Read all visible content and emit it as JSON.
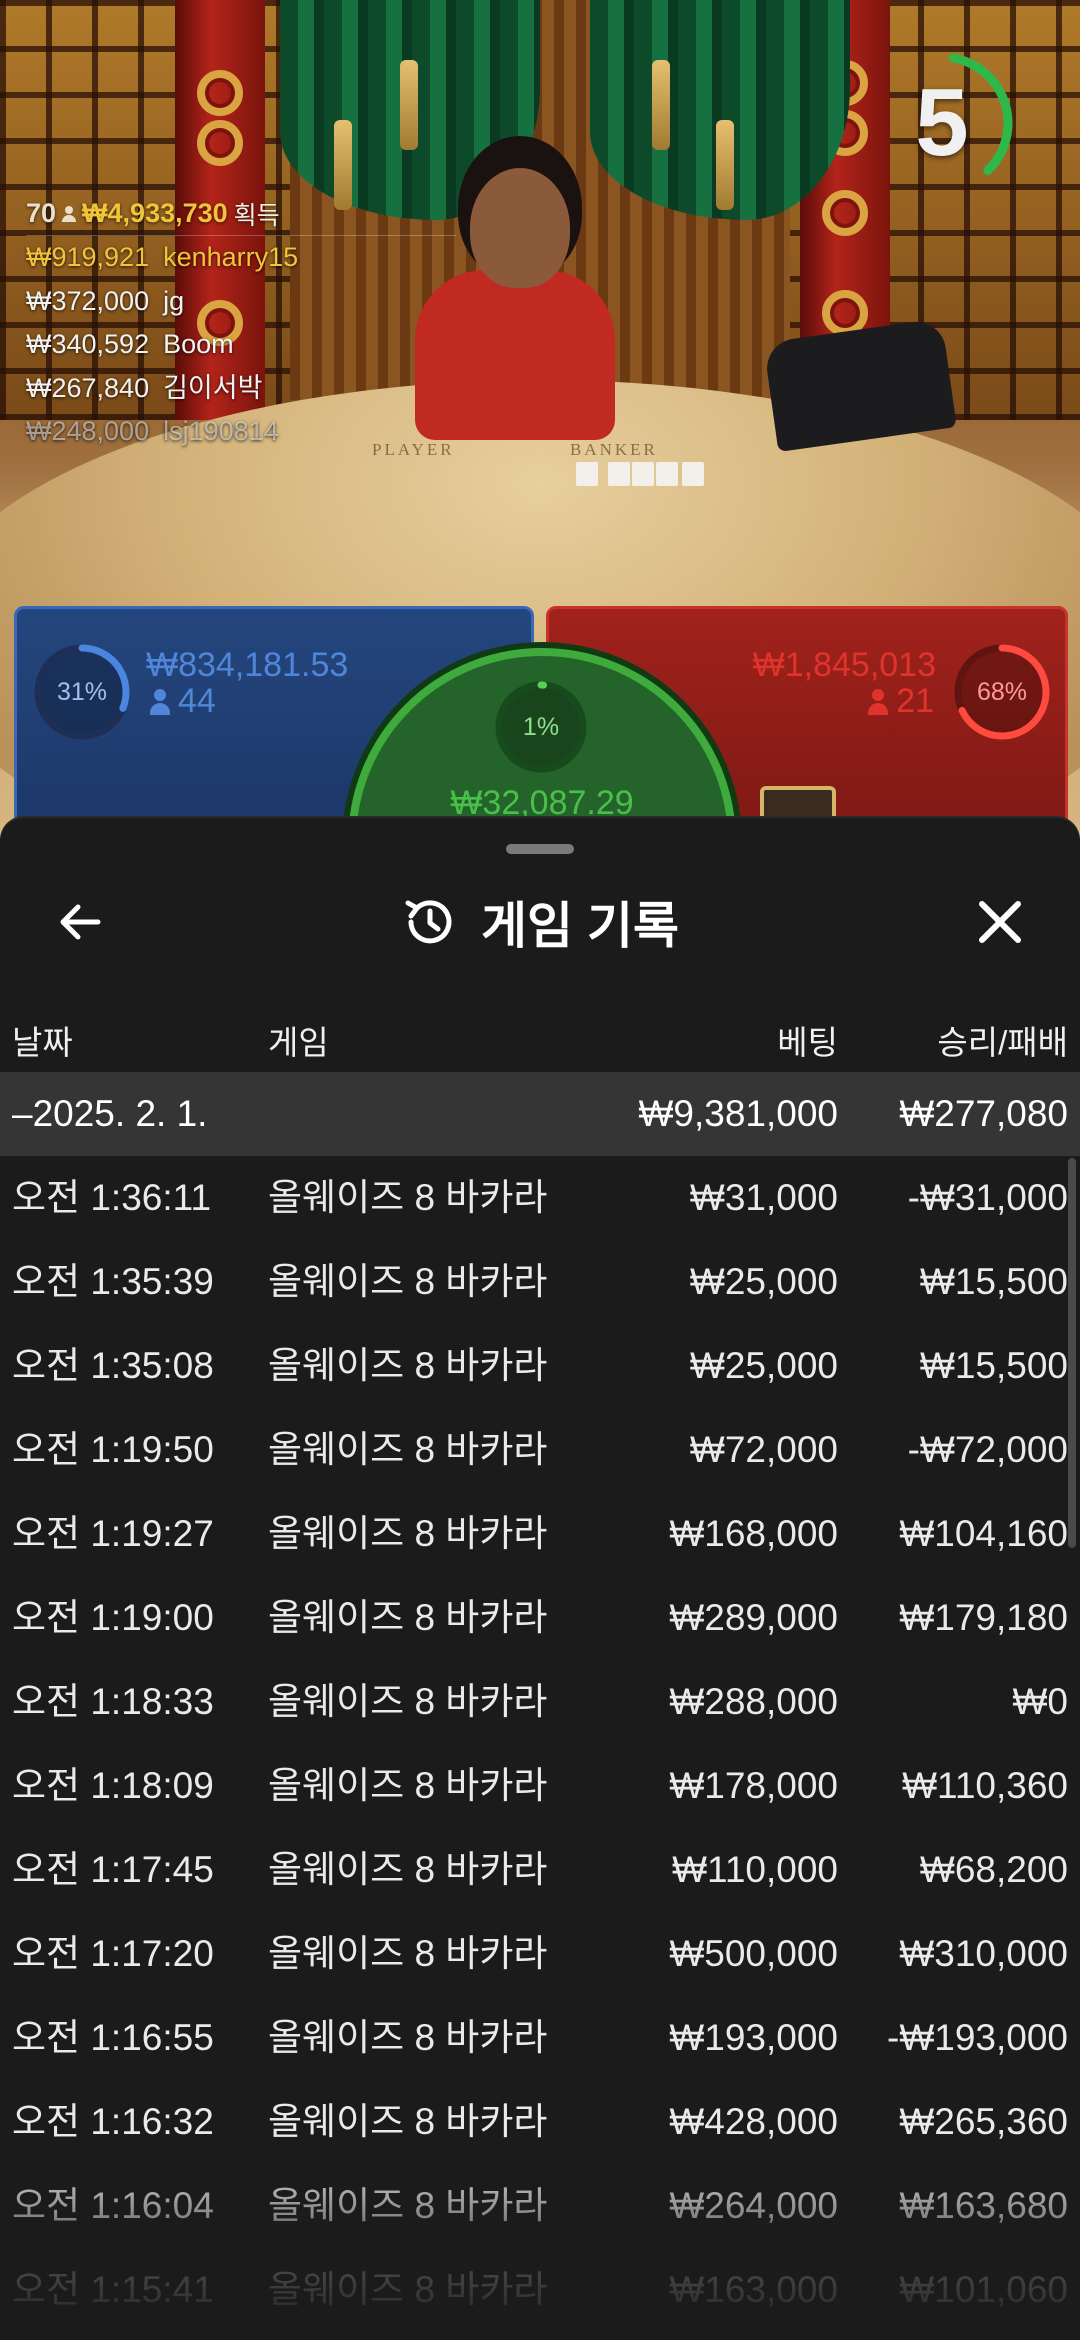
{
  "colors": {
    "player_blue": "#3b6fc4",
    "banker_red": "#e0332b",
    "tie_green": "#3eab3c",
    "gold": "#f1c53a",
    "sheet_bg": "#1b1b1b",
    "summary_bg": "#353535"
  },
  "video": {
    "timer": {
      "value": "5",
      "progress": 0.35
    },
    "table_labels": {
      "player": "PLAYER",
      "banker": "BANKER"
    },
    "leaderboard": {
      "count": "70",
      "total": "₩4,933,730",
      "suffix": "획득",
      "rows": [
        {
          "amount": "₩919,921",
          "name": "kenharry15"
        },
        {
          "amount": "₩372,000",
          "name": "jg"
        },
        {
          "amount": "₩340,592",
          "name": "Boom"
        },
        {
          "amount": "₩267,840",
          "name": "김이서박"
        },
        {
          "amount": "₩248,000",
          "name": "lsj190814"
        }
      ]
    },
    "bets": {
      "player": {
        "percent": "31%",
        "percent_value": 0.31,
        "amount": "₩834,181.53",
        "count": "44"
      },
      "banker": {
        "percent": "68%",
        "percent_value": 0.68,
        "amount": "₩1,845,013",
        "count": "21"
      },
      "tie": {
        "percent": "1%",
        "percent_value": 0.01,
        "amount": "₩32,087.29"
      }
    }
  },
  "history": {
    "title": "게임 기록",
    "icons": {
      "back": "arrow-left-icon",
      "title": "history-icon",
      "close": "close-icon"
    },
    "columns": {
      "date": "날짜",
      "game": "게임",
      "bet": "베팅",
      "result": "승리/패배"
    },
    "summary": {
      "date": "–2025. 2. 1.",
      "bet": "₩9,381,000",
      "result": "₩277,080"
    },
    "rows": [
      {
        "time": "오전 1:36:11",
        "game": "올웨이즈 8 바카라",
        "bet": "₩31,000",
        "result": "-₩31,000"
      },
      {
        "time": "오전 1:35:39",
        "game": "올웨이즈 8 바카라",
        "bet": "₩25,000",
        "result": "₩15,500"
      },
      {
        "time": "오전 1:35:08",
        "game": "올웨이즈 8 바카라",
        "bet": "₩25,000",
        "result": "₩15,500"
      },
      {
        "time": "오전 1:19:50",
        "game": "올웨이즈 8 바카라",
        "bet": "₩72,000",
        "result": "-₩72,000"
      },
      {
        "time": "오전 1:19:27",
        "game": "올웨이즈 8 바카라",
        "bet": "₩168,000",
        "result": "₩104,160"
      },
      {
        "time": "오전 1:19:00",
        "game": "올웨이즈 8 바카라",
        "bet": "₩289,000",
        "result": "₩179,180"
      },
      {
        "time": "오전 1:18:33",
        "game": "올웨이즈 8 바카라",
        "bet": "₩288,000",
        "result": "₩0"
      },
      {
        "time": "오전 1:18:09",
        "game": "올웨이즈 8 바카라",
        "bet": "₩178,000",
        "result": "₩110,360"
      },
      {
        "time": "오전 1:17:45",
        "game": "올웨이즈 8 바카라",
        "bet": "₩110,000",
        "result": "₩68,200"
      },
      {
        "time": "오전 1:17:20",
        "game": "올웨이즈 8 바카라",
        "bet": "₩500,000",
        "result": "₩310,000"
      },
      {
        "time": "오전 1:16:55",
        "game": "올웨이즈 8 바카라",
        "bet": "₩193,000",
        "result": "-₩193,000"
      },
      {
        "time": "오전 1:16:32",
        "game": "올웨이즈 8 바카라",
        "bet": "₩428,000",
        "result": "₩265,360"
      },
      {
        "time": "오전 1:16:04",
        "game": "올웨이즈 8 바카라",
        "bet": "₩264,000",
        "result": "₩163,680"
      },
      {
        "time": "오전 1:15:41",
        "game": "올웨이즈 8 바카라",
        "bet": "₩163,000",
        "result": "₩101,060"
      }
    ]
  }
}
